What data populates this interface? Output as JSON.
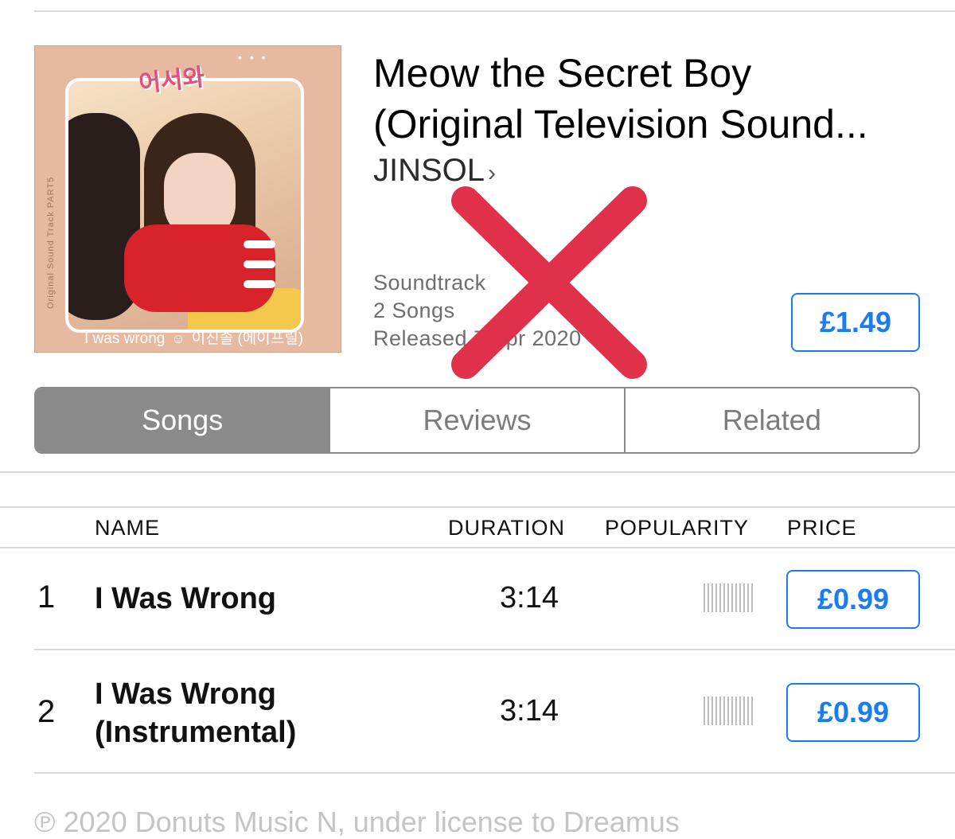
{
  "album": {
    "title_line1": "Meow the Secret Boy",
    "title_line2": "(Original Television Sound...",
    "artist": "JINSOL",
    "artist_chevron": "›",
    "genre": "Soundtrack",
    "song_count": "2 Songs",
    "released": "Released 7 Apr 2020",
    "price": "£1.49",
    "artwork": {
      "logo": "어서와",
      "paws": "• • •",
      "side_text": "Original Sound Track PART5",
      "caption_left": "I was wrong",
      "caption_icon": "cat-icon",
      "caption_right": "이진솔 (에이프릴)"
    }
  },
  "tabs": [
    {
      "label": "Songs",
      "selected": true
    },
    {
      "label": "Reviews",
      "selected": false
    },
    {
      "label": "Related",
      "selected": false
    }
  ],
  "table": {
    "headers": {
      "name": "NAME",
      "duration": "DURATION",
      "popularity": "POPULARITY",
      "price": "PRICE"
    },
    "rows": [
      {
        "num": "1",
        "name_line1": "I Was Wrong",
        "name_line2": "",
        "duration": "3:14",
        "price": "£0.99"
      },
      {
        "num": "2",
        "name_line1": "I Was Wrong",
        "name_line2": "(Instrumental)",
        "duration": "3:14",
        "price": "£0.99"
      }
    ]
  },
  "footer": {
    "copyright": "℗ 2020 Donuts Music N, under license to Dreamus"
  },
  "colors": {
    "accent": "#1a7cf0",
    "segment_selected": "#8a8a8a",
    "x_mark": "#e0304a"
  }
}
